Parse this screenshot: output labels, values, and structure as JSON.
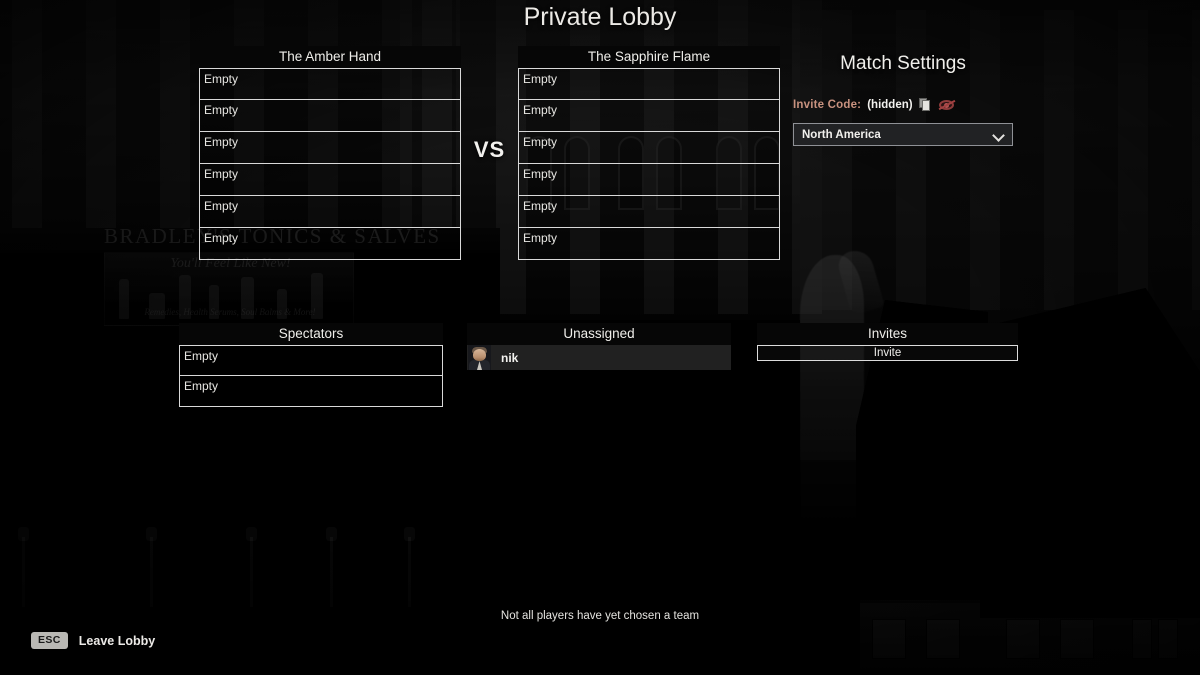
{
  "title": "Private Lobby",
  "vs_label": "VS",
  "teams": [
    {
      "name": "The Amber Hand",
      "slots": [
        "Empty",
        "Empty",
        "Empty",
        "Empty",
        "Empty",
        "Empty"
      ]
    },
    {
      "name": "The Sapphire Flame",
      "slots": [
        "Empty",
        "Empty",
        "Empty",
        "Empty",
        "Empty",
        "Empty"
      ]
    }
  ],
  "spectators": {
    "header": "Spectators",
    "slots": [
      "Empty",
      "Empty"
    ]
  },
  "unassigned": {
    "header": "Unassigned",
    "players": [
      {
        "name": "nik",
        "avatar": "player-portrait"
      }
    ]
  },
  "invites": {
    "header": "Invites",
    "button_label": "Invite"
  },
  "match_settings": {
    "title": "Match Settings",
    "invite_code_label": "Invite Code:",
    "invite_code_value": "(hidden)",
    "copy_icon": "copy-icon",
    "reveal_icon": "eye-slash-icon",
    "region_selected": "North America",
    "region_chevron_icon": "chevron-down-icon"
  },
  "status_message": "Not all players have yet chosen a team",
  "footer": {
    "key": "ESC",
    "label": "Leave Lobby"
  },
  "colors": {
    "invite_label": "#c8927f",
    "panel_header_bg": "#060606",
    "slot_border": "#d9d9d9",
    "text_primary": "#f0efec",
    "key_badge_bg": "#b9b8b4"
  },
  "background": {
    "sign_text": "BRADLEY'S   TONICS & SALVES",
    "poster_script": "You'll Feel Like New!",
    "poster_sub": "Remedies, Health Serums, Soul Balms & More!"
  }
}
